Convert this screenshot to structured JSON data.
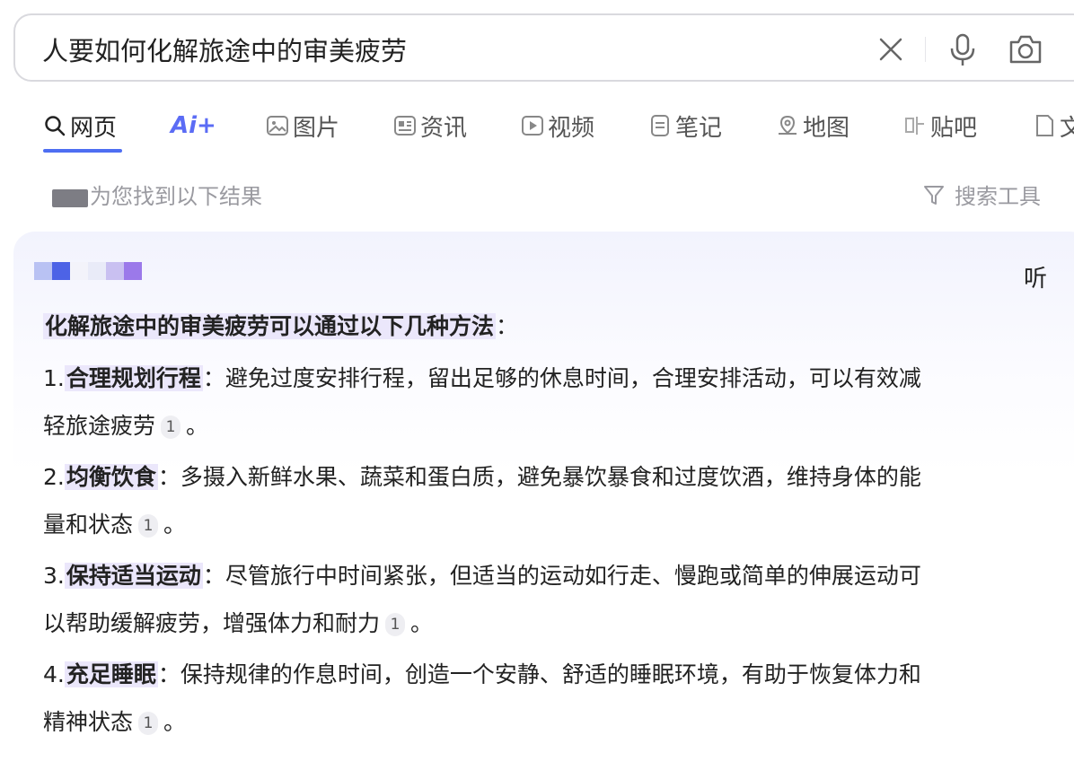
{
  "search": {
    "query": "人要如何化解旅途中的审美疲劳"
  },
  "tabs": [
    {
      "label": "网页",
      "icon": "search-icon",
      "active": true
    },
    {
      "label": "Ai+",
      "icon": "ai-icon"
    },
    {
      "label": "图片",
      "icon": "image-icon"
    },
    {
      "label": "资讯",
      "icon": "news-icon"
    },
    {
      "label": "视频",
      "icon": "video-icon"
    },
    {
      "label": "笔记",
      "icon": "note-icon"
    },
    {
      "label": "地图",
      "icon": "map-icon"
    },
    {
      "label": "贴吧",
      "icon": "tieba-icon"
    },
    {
      "label": "文",
      "icon": "doc-icon"
    }
  ],
  "results": {
    "found_text": "为您找到以下结果",
    "tools_label": "搜索工具"
  },
  "ai_answer": {
    "listen_label": "听",
    "intro": "化解旅途中的审美疲劳可以通过以下几种方法",
    "colon": "：",
    "items": [
      {
        "num": "1.",
        "title": "合理规划行程",
        "line1": "：避免过度安排行程，留出足够的休息时间，合理安排活动，可以有效减",
        "line2": "轻旅途疲劳",
        "cite": "1"
      },
      {
        "num": "2.",
        "title": "均衡饮食",
        "line1": "：多摄入新鲜水果、蔬菜和蛋白质，避免暴饮暴食和过度饮酒，维持身体的能",
        "line2": "量和状态",
        "cite": "1"
      },
      {
        "num": "3.",
        "title": "保持适当运动",
        "line1": "：尽管旅行中时间紧张，但适当的运动如行走、慢跑或简单的伸展运动可",
        "line2": "以帮助缓解疲劳，增强体力和耐力",
        "cite": "1"
      },
      {
        "num": "4.",
        "title": "充足睡眠",
        "line1": "：保持规律的作息时间，创造一个安静、舒适的睡眠环境，有助于恢复体力和",
        "line2": "精神状态",
        "cite": "1"
      }
    ],
    "end_mark": "。"
  },
  "colors": {
    "accent": "#4e6ef2",
    "highlight": "#ebe7fb",
    "muted": "#9a9aa0"
  }
}
